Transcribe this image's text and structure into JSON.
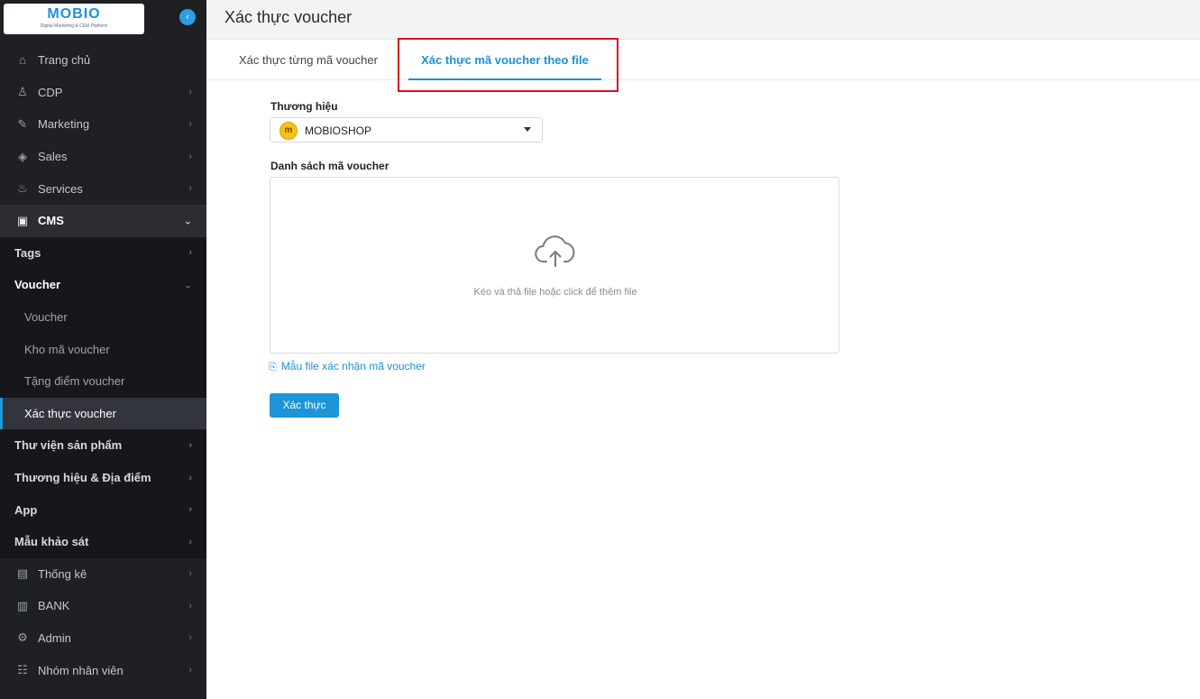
{
  "sidebar": {
    "logo_text": "MOBIO",
    "logo_subtext": "Digital Marketing & CEM Platform",
    "collapse_icon": "‹",
    "items": [
      {
        "label": "Trang chủ",
        "icon": "⌂"
      },
      {
        "label": "CDP",
        "icon": "♙"
      },
      {
        "label": "Marketing",
        "icon": "✎"
      },
      {
        "label": "Sales",
        "icon": "◈"
      },
      {
        "label": "Services",
        "icon": "♨"
      },
      {
        "label": "CMS",
        "icon": "▣"
      },
      {
        "label": "Tags"
      },
      {
        "label": "Voucher"
      },
      {
        "label": "Voucher"
      },
      {
        "label": "Kho mã voucher"
      },
      {
        "label": "Tặng điểm voucher"
      },
      {
        "label": "Xác thực voucher"
      },
      {
        "label": "Thư viện sản phẩm"
      },
      {
        "label": "Thương hiệu & Địa điểm"
      },
      {
        "label": "App"
      },
      {
        "label": "Mẫu khảo sát"
      },
      {
        "label": "Thống kê",
        "icon": "▤"
      },
      {
        "label": "BANK",
        "icon": "▥"
      },
      {
        "label": "Admin",
        "icon": "⚙"
      },
      {
        "label": "Nhóm nhân viên",
        "icon": "☷"
      }
    ]
  },
  "header": {
    "title": "Xác thực voucher"
  },
  "tabs": [
    {
      "label": "Xác thực từng mã voucher"
    },
    {
      "label": "Xác thực mã voucher theo file",
      "active": true
    }
  ],
  "form": {
    "brand_label": "Thương hiệu",
    "brand_value": "MOBIOSHOP",
    "brand_logo_letter": "m",
    "list_label": "Danh sách mã voucher",
    "dropzone_text": "Kéo và thả file hoặc click để thêm file",
    "template_link": "Mẫu file xác nhận mã voucher",
    "verify_button": "Xác thực"
  },
  "colors": {
    "accent": "#1d95d6",
    "highlight": "#d8101a",
    "sidebar_bg": "#1f2024"
  }
}
